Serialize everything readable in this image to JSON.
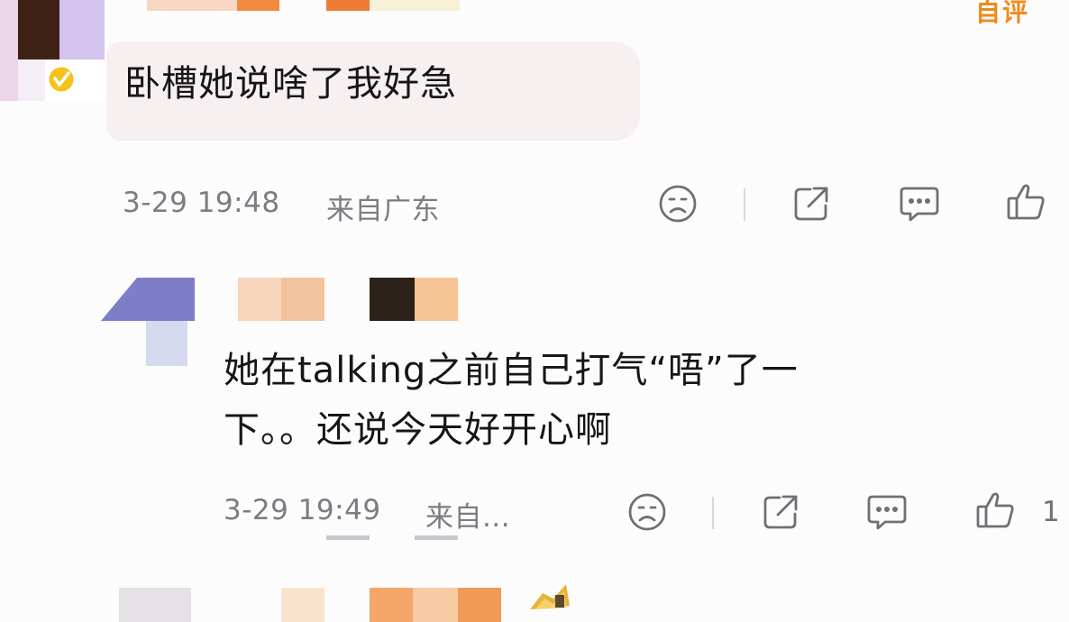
{
  "header": {
    "cut_label": "自评"
  },
  "comments": [
    {
      "text": "卧槽她说啥了我好急",
      "time": "3-29 19:48",
      "location": "来自广东",
      "like_count": ""
    },
    {
      "text_line1": "她在talking之前自己打气“唔”了一",
      "text_line2": "下。。还说今天好开心啊",
      "time": "3-29 19:49",
      "location": "来自...",
      "like_count": "1"
    }
  ],
  "icons": {
    "dislike": "sad-face-icon",
    "share": "share-icon",
    "comment": "comment-icon",
    "like": "thumbs-up-icon",
    "verified": "verified-badge-icon"
  },
  "colors": {
    "bubble": "#f6f0f1",
    "meta_text": "#7c7c82",
    "verified_badge": "#f5c21b",
    "icon_stroke": "#6f6f75"
  }
}
